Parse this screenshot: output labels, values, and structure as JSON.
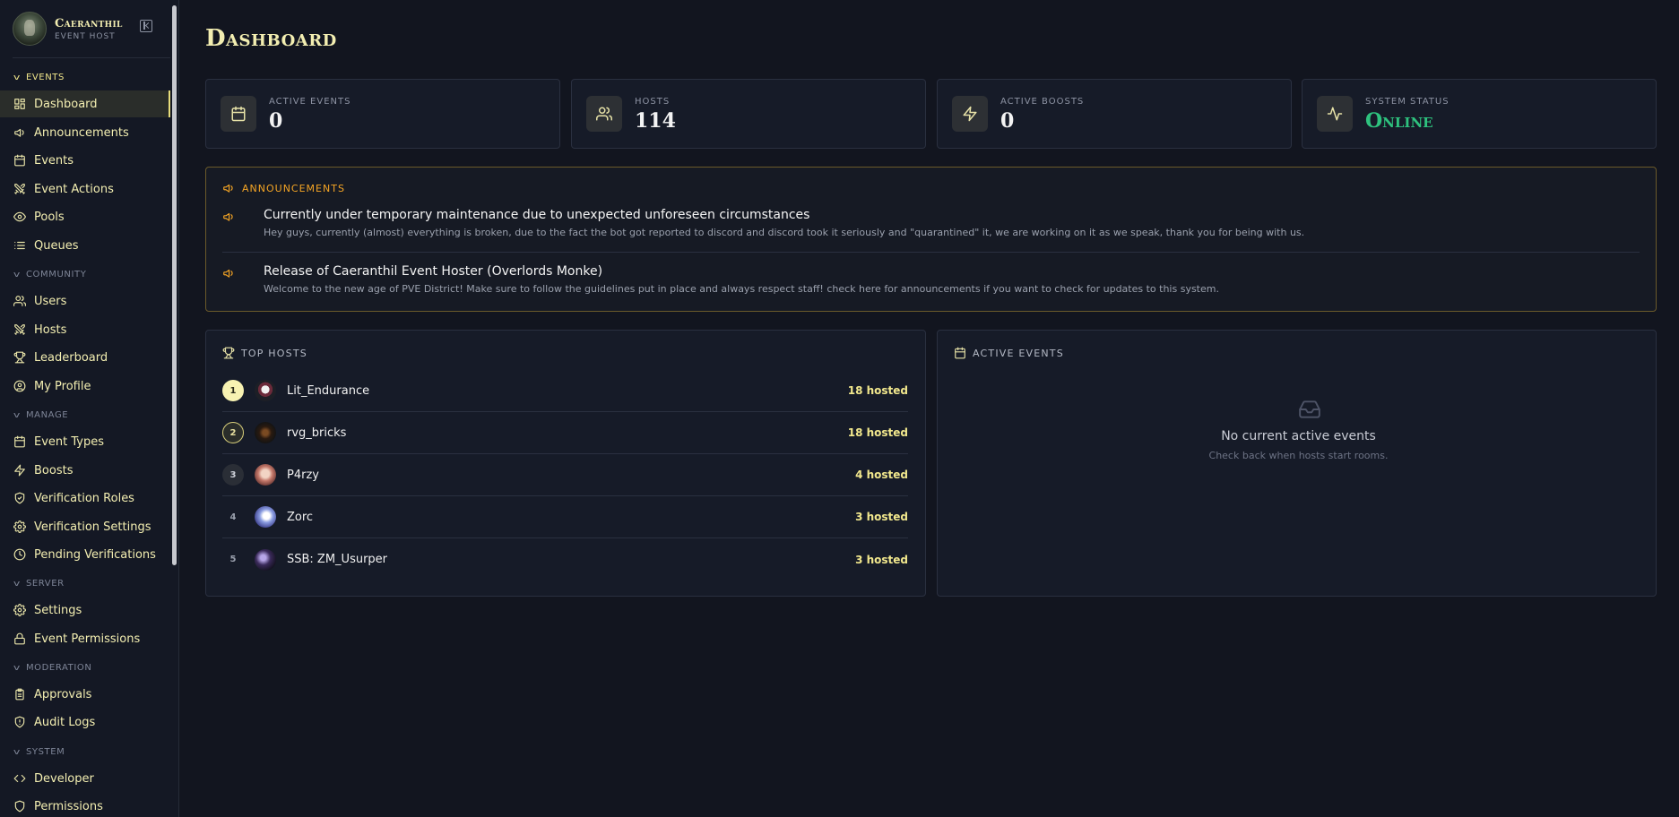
{
  "brand": {
    "name": "Caeranthil",
    "subtitle": "EVENT HOST"
  },
  "sidebar": {
    "sections": [
      {
        "label": "EVENTS",
        "items": [
          {
            "label": "Dashboard",
            "icon": "dashboard-icon",
            "active": true
          },
          {
            "label": "Announcements",
            "icon": "megaphone-icon"
          },
          {
            "label": "Events",
            "icon": "calendar-icon"
          },
          {
            "label": "Event Actions",
            "icon": "swords-icon"
          },
          {
            "label": "Pools",
            "icon": "eye-icon"
          },
          {
            "label": "Queues",
            "icon": "list-icon"
          }
        ]
      },
      {
        "label": "COMMUNITY",
        "items": [
          {
            "label": "Users",
            "icon": "users-icon"
          },
          {
            "label": "Hosts",
            "icon": "swords-icon"
          },
          {
            "label": "Leaderboard",
            "icon": "trophy-icon"
          },
          {
            "label": "My Profile",
            "icon": "user-circle-icon"
          }
        ]
      },
      {
        "label": "MANAGE",
        "items": [
          {
            "label": "Event Types",
            "icon": "calendar-icon"
          },
          {
            "label": "Boosts",
            "icon": "zap-icon"
          },
          {
            "label": "Verification Roles",
            "icon": "shield-check-icon"
          },
          {
            "label": "Verification Settings",
            "icon": "gear-icon"
          },
          {
            "label": "Pending Verifications",
            "icon": "clock-icon"
          }
        ]
      },
      {
        "label": "SERVER",
        "items": [
          {
            "label": "Settings",
            "icon": "gear-icon"
          },
          {
            "label": "Event Permissions",
            "icon": "lock-icon"
          }
        ]
      },
      {
        "label": "MODERATION",
        "items": [
          {
            "label": "Approvals",
            "icon": "clipboard-icon"
          },
          {
            "label": "Audit Logs",
            "icon": "shield-alert-icon"
          }
        ]
      },
      {
        "label": "SYSTEM",
        "items": [
          {
            "label": "Developer",
            "icon": "code-icon"
          },
          {
            "label": "Permissions",
            "icon": "shield-icon"
          }
        ]
      }
    ]
  },
  "page": {
    "title": "Dashboard"
  },
  "stats": [
    {
      "label": "ACTIVE EVENTS",
      "value": "0",
      "icon": "calendar-icon"
    },
    {
      "label": "HOSTS",
      "value": "114",
      "icon": "users-icon"
    },
    {
      "label": "ACTIVE BOOSTS",
      "value": "0",
      "icon": "zap-icon"
    },
    {
      "label": "SYSTEM STATUS",
      "value": "Online",
      "icon": "activity-icon"
    }
  ],
  "announcements": {
    "heading": "ANNOUNCEMENTS",
    "items": [
      {
        "title": "Currently under temporary maintenance due to unexpected unforeseen circumstances",
        "body": "Hey guys, currently (almost) everything is broken, due to the fact the bot got reported to discord and discord took it seriously and \"quarantined\" it, we are working on it as we speak, thank you for being with us."
      },
      {
        "title": "Release of Caeranthil Event Hoster (Overlords Monke)",
        "body": "Welcome to the new age of PVE District! Make sure to follow the guidelines put in place and always respect staff! check here for announcements if you want to check for updates to this system."
      }
    ]
  },
  "top_hosts": {
    "heading": "TOP HOSTS",
    "rows": [
      {
        "rank": "1",
        "name": "Lit_Endurance",
        "count": "18 hosted"
      },
      {
        "rank": "2",
        "name": "rvg_bricks",
        "count": "18 hosted"
      },
      {
        "rank": "3",
        "name": "P4rzy",
        "count": "4 hosted"
      },
      {
        "rank": "4",
        "name": "Zorc",
        "count": "3 hosted"
      },
      {
        "rank": "5",
        "name": "SSB: ZM_Usurper",
        "count": "3 hosted"
      }
    ]
  },
  "active_events": {
    "heading": "ACTIVE EVENTS",
    "empty_title": "No current active events",
    "empty_sub": "Check back when hosts start rooms."
  },
  "colors": {
    "accent": "#f3eeb1",
    "online": "#2ec27e",
    "announcement": "#f5a524",
    "background": "#12151f"
  }
}
